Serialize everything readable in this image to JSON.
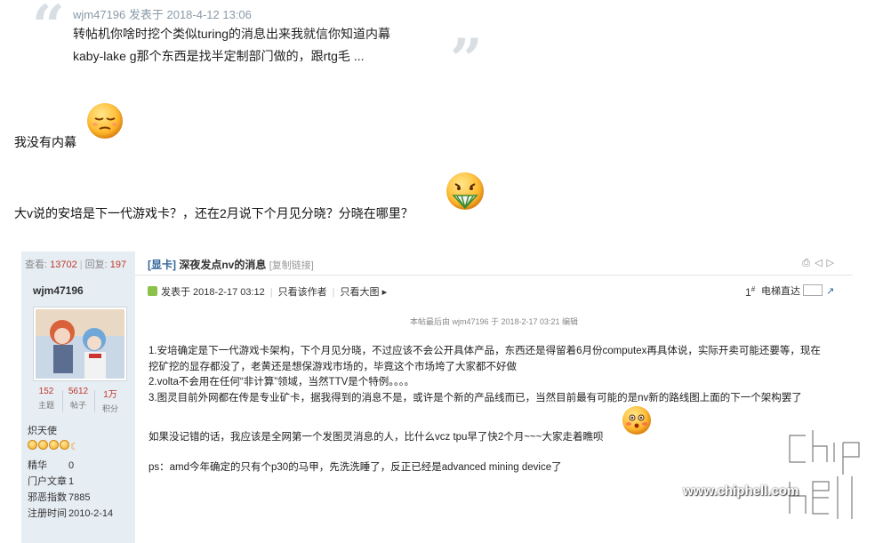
{
  "quote": {
    "meta": "wjm47196 发表于 2018-4-12 13:06",
    "line1": "转帖机你啥时挖个类似turing的消息出来我就信你知道内幕",
    "line2": "kaby-lake g那个东西是找半定制部门做的，跟rtg毛 ..."
  },
  "reply": {
    "line1": "我没有内幕",
    "line2": "大v说的安培是下一代游戏卡？，还在2月说下个月见分晓？分晓在哪里？"
  },
  "embedded_post": {
    "stats": {
      "views_label": "查看:",
      "views": "13702",
      "replies_label": "回复:",
      "replies": "197"
    },
    "user": {
      "name": "wjm47196",
      "counts": [
        {
          "value": "152",
          "label": "主题"
        },
        {
          "value": "5612",
          "label": "帖子"
        },
        {
          "value": "1万",
          "label": "积分"
        }
      ],
      "rank": "炽天使",
      "info": [
        {
          "key": "精华",
          "value": "0"
        },
        {
          "key": "门户文章",
          "value": "1"
        },
        {
          "key": "邪恶指数",
          "value": "7885"
        },
        {
          "key": "注册时间",
          "value": "2010-2-14"
        }
      ]
    },
    "title": {
      "category": "[显卡]",
      "text": "深夜发点nv的消息",
      "copy_link": "[复制链接]"
    },
    "post_info": {
      "posted": "发表于 2018-2-17 03:12",
      "only_author": "只看该作者",
      "big_image": "只看大图",
      "floor": "1",
      "floor_suffix": "#",
      "jump_label": "电梯直达"
    },
    "edited_note": "本帖最后由 wjm47196 于 2018-2-17 03:21 编辑",
    "body": [
      "1.安培确定是下一代游戏卡架构，下个月见分晓，不过应该不会公开具体产品，东西还是得留着6月份computex再具体说，实际开卖可能还要等，现在",
      "挖矿挖的显存都没了，老黄还是想保游戏市场的，毕竟这个市场垮了大家都不好做",
      "2.volta不会用在任何“非计算”领域，当然TTV是个特例。。。。",
      "3.图灵目前外网都在传是专业矿卡，据我得到的消息不是，或许是个新的产品线而已，当然目前最有可能的是nv新的路线图上面的下一个架构罢了",
      "如果没记错的话，我应该是全网第一个发图灵消息的人，比什么vcz tpu早了快2个月~~~大家走着瞧呗",
      "ps：amd今年确定的只有个p30的马甲，先洗洗睡了，反正已经是advanced mining device了"
    ]
  },
  "watermark": {
    "site": "www.chiphell.com"
  }
}
